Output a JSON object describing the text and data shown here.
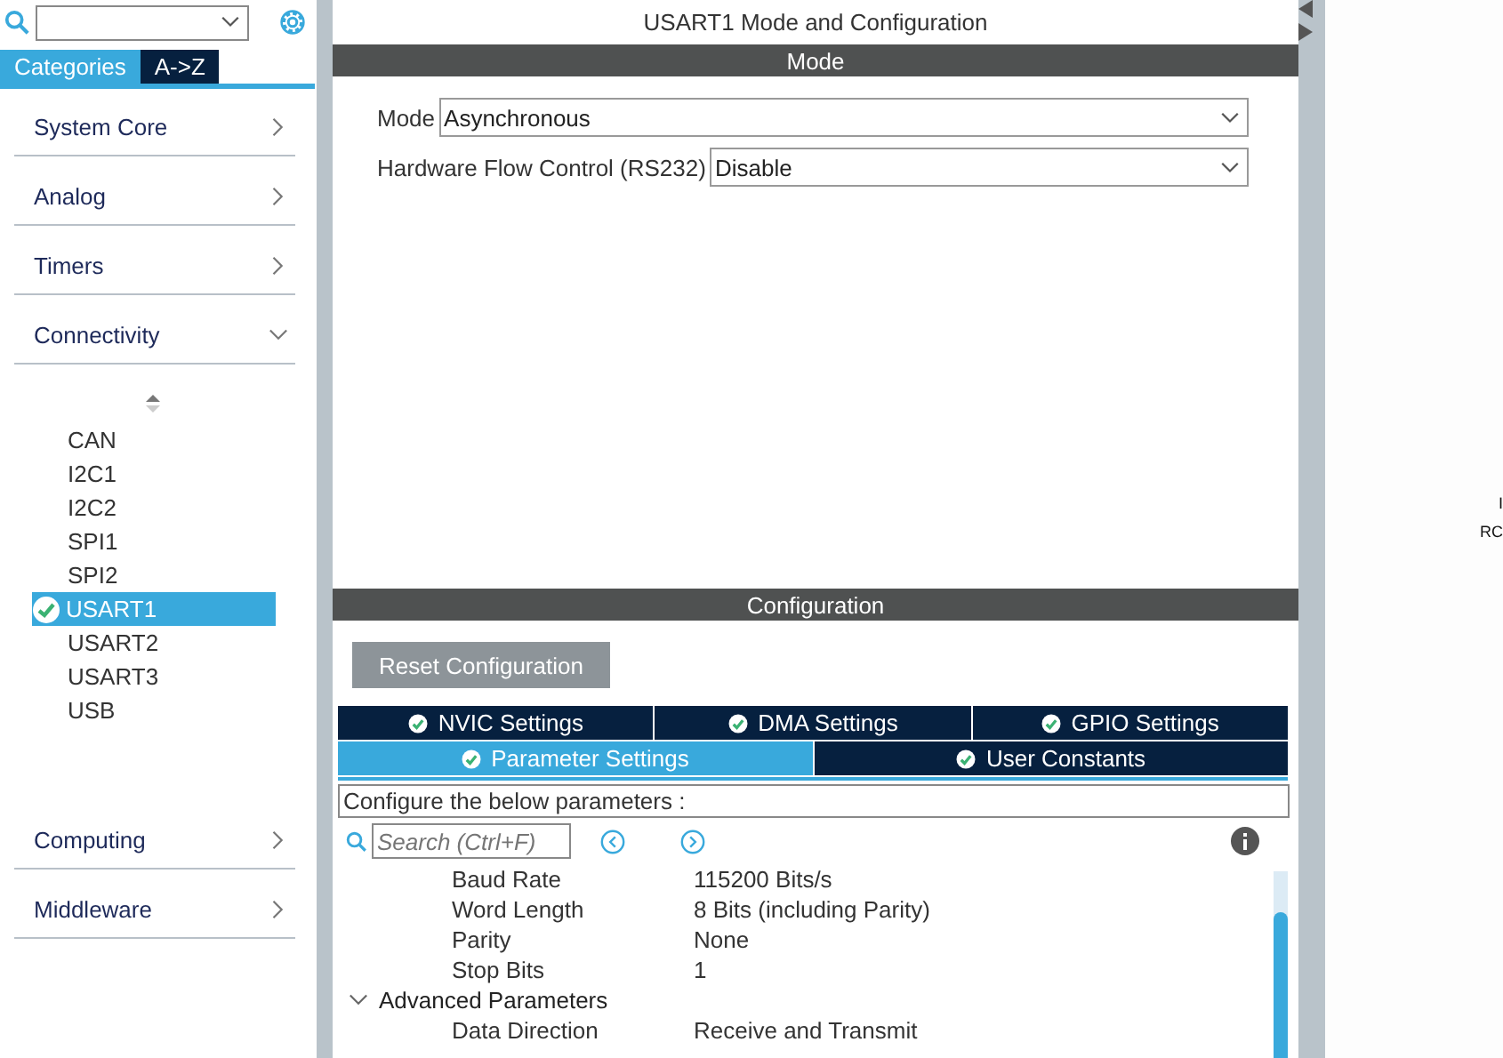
{
  "sidebar_tabs": [
    {
      "label": "Categories",
      "selected": true
    },
    {
      "label": "A->Z",
      "selected": false
    }
  ],
  "categories": [
    {
      "label": "System Core",
      "expanded": false
    },
    {
      "label": "Analog",
      "expanded": false
    },
    {
      "label": "Timers",
      "expanded": false
    },
    {
      "label": "Connectivity",
      "expanded": true,
      "children": [
        {
          "label": "CAN",
          "selected": false,
          "configured": false
        },
        {
          "label": "I2C1",
          "selected": false,
          "configured": false
        },
        {
          "label": "I2C2",
          "selected": false,
          "configured": false
        },
        {
          "label": "SPI1",
          "selected": false,
          "configured": false
        },
        {
          "label": "SPI2",
          "selected": false,
          "configured": false
        },
        {
          "label": "USART1",
          "selected": true,
          "configured": true
        },
        {
          "label": "USART2",
          "selected": false,
          "configured": false
        },
        {
          "label": "USART3",
          "selected": false,
          "configured": false
        },
        {
          "label": "USB",
          "selected": false,
          "configured": false
        }
      ]
    },
    {
      "label": "Computing",
      "expanded": false
    },
    {
      "label": "Middleware",
      "expanded": false
    }
  ],
  "title": "USART1 Mode and Configuration",
  "mode_section": {
    "heading": "Mode",
    "fields": [
      {
        "label": "Mode",
        "value": "Asynchronous"
      },
      {
        "label": "Hardware Flow Control (RS232)",
        "value": "Disable"
      }
    ]
  },
  "config_section": {
    "heading": "Configuration",
    "reset_button": "Reset Configuration",
    "tab_rows": [
      [
        {
          "label": "NVIC Settings",
          "selected": false
        },
        {
          "label": "DMA Settings",
          "selected": false
        },
        {
          "label": "GPIO Settings",
          "selected": false
        }
      ],
      [
        {
          "label": "Parameter Settings",
          "selected": true
        },
        {
          "label": "User Constants",
          "selected": false
        }
      ]
    ],
    "description": "Configure the below parameters :",
    "search": {
      "placeholder": "Search (Ctrl+F)"
    },
    "parameters": [
      {
        "kind": "param",
        "name": "Baud Rate",
        "value": "115200 Bits/s"
      },
      {
        "kind": "param",
        "name": "Word Length",
        "value": "8 Bits (including Parity)"
      },
      {
        "kind": "param",
        "name": "Parity",
        "value": "None"
      },
      {
        "kind": "param",
        "name": "Stop Bits",
        "value": "1"
      },
      {
        "kind": "group",
        "name": "Advanced Parameters",
        "expanded": true
      },
      {
        "kind": "param",
        "name": "Data Direction",
        "value": "Receive and Transmit"
      }
    ]
  },
  "canvas_labels": [
    "I",
    "RC"
  ]
}
